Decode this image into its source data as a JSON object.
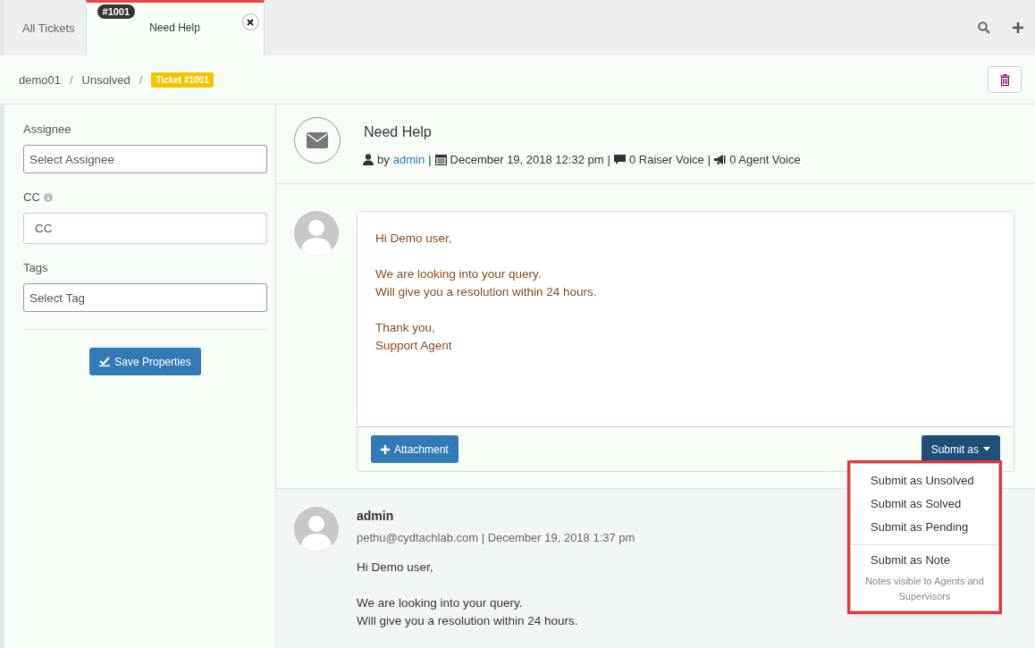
{
  "tabs": [
    {
      "kind": "plain",
      "label": "All Tickets",
      "selected": false
    },
    {
      "kind": "ticket",
      "badge": "#1001",
      "label": "Need Help",
      "selected": true
    }
  ],
  "breadcrumb": [
    {
      "kind": "link",
      "text": "demo01"
    },
    {
      "kind": "separator",
      "text": "/"
    },
    {
      "kind": "link",
      "text": "Unsolved"
    },
    {
      "kind": "separator",
      "text": "/"
    },
    {
      "kind": "badge",
      "text": "Ticket #1001"
    }
  ],
  "sidebar": {
    "fields": [
      {
        "label": "Assignee",
        "placeholder": "Select Assignee",
        "info": false
      },
      {
        "label": "CC",
        "placeholder": "CC",
        "info": true
      },
      {
        "label": "Tags",
        "placeholder": "Select Tag",
        "info": false
      }
    ],
    "save_button": "Save Properties"
  },
  "ticket": {
    "title": "Need Help",
    "meta": [
      {
        "kind": "author",
        "prefix": "by",
        "link": "admin"
      },
      {
        "kind": "separator",
        "text": "|"
      },
      {
        "kind": "date",
        "text": "December 19, 2018 12:32 pm"
      },
      {
        "kind": "separator",
        "text": "|"
      },
      {
        "kind": "raiser",
        "text": "0 Raiser Voice"
      },
      {
        "kind": "separator",
        "text": "|"
      },
      {
        "kind": "agent",
        "text": "0 Agent Voice"
      }
    ]
  },
  "reply": {
    "value": [
      [
        "Hi Demo user,"
      ],
      [
        "We are looking into your query.",
        "Will give you a resolution within 24 hours."
      ],
      [
        "Thank you,",
        "Support Agent"
      ]
    ],
    "attachment_button": "Attachment",
    "submit_button": "Submit as",
    "menu": [
      {
        "kind": "item",
        "text": "Submit as Unsolved"
      },
      {
        "kind": "item",
        "text": "Submit as Solved"
      },
      {
        "kind": "item",
        "text": "Submit as Pending"
      },
      {
        "kind": "divider"
      },
      {
        "kind": "item",
        "text": "Submit as Note"
      },
      {
        "kind": "hint",
        "text": "Notes visible to Agents and Supervisors"
      }
    ]
  },
  "messages": [
    {
      "author": "admin",
      "meta": "pethu@cydtachlab.com | December 19, 2018 1:37 pm",
      "body": [
        [
          "Hi Demo user,"
        ],
        [
          "We are looking into your query.",
          "Will give you a resolution within 24 hours."
        ]
      ]
    }
  ]
}
